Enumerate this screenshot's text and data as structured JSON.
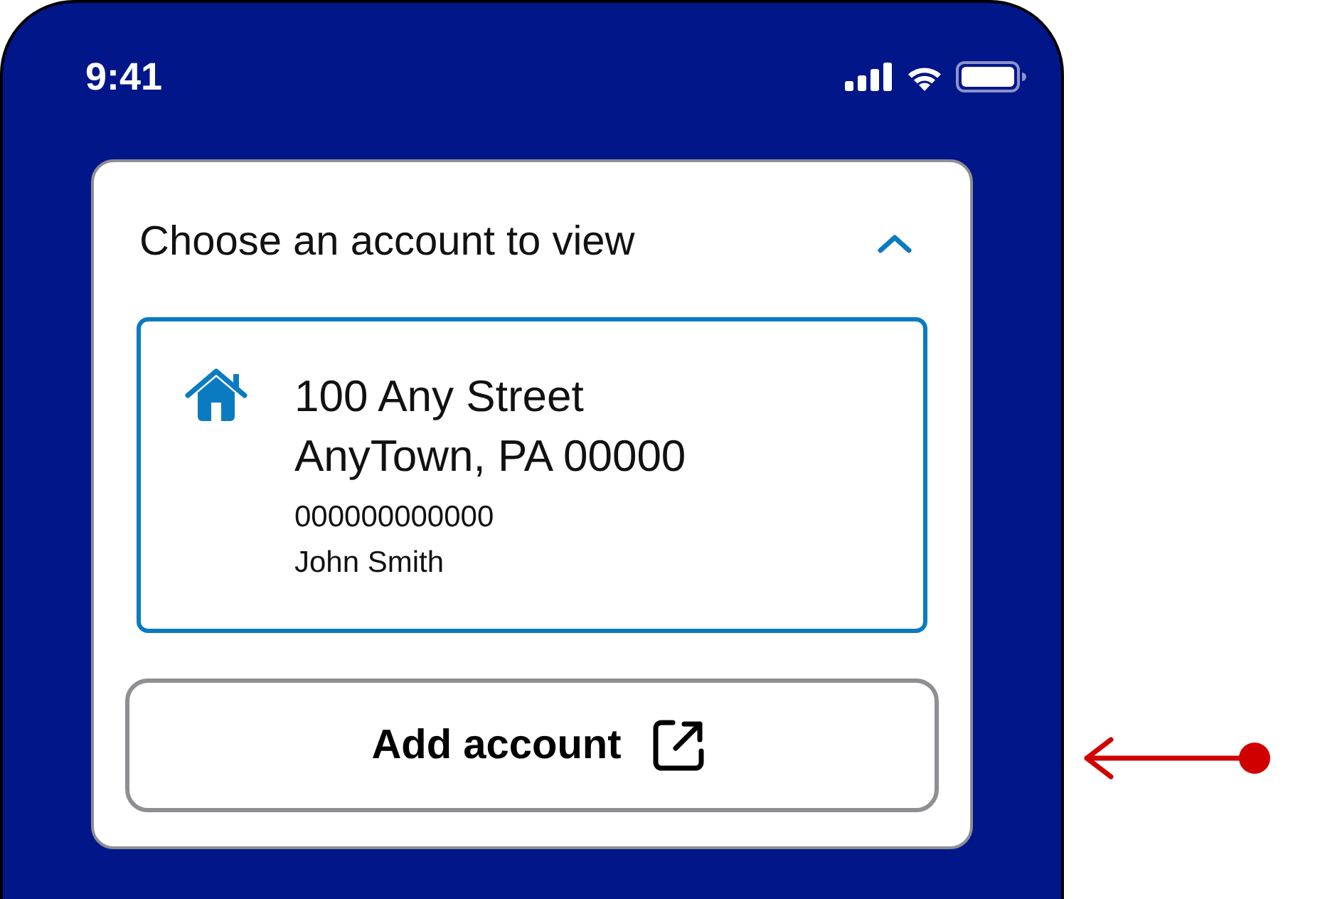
{
  "status_bar": {
    "time": "9:41"
  },
  "account_picker": {
    "title": "Choose an account to view",
    "expanded": true,
    "accounts": [
      {
        "address_line_1": "100 Any Street",
        "address_line_2": "AnyTown, PA 00000",
        "account_number": "000000000000",
        "name": "John Smith",
        "selected": true
      }
    ],
    "add_button": {
      "label": "Add account"
    }
  }
}
